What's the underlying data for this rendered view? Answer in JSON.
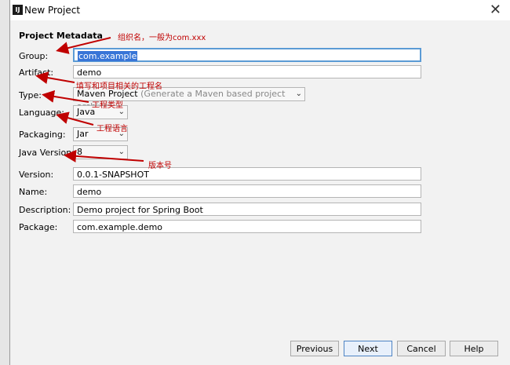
{
  "window": {
    "title": "New Project"
  },
  "section_title": "Project Metadata",
  "fields": {
    "group": {
      "label": "Group:",
      "value": "com.example"
    },
    "artifact": {
      "label": "Artifact:",
      "value": "demo"
    },
    "type": {
      "label": "Type:",
      "value": "Maven Project",
      "hint": "(Generate a Maven based project archive)"
    },
    "language": {
      "label": "Language:",
      "value": "Java"
    },
    "packaging": {
      "label": "Packaging:",
      "value": "Jar"
    },
    "java_version": {
      "label": "Java Version:",
      "value": "8"
    },
    "version": {
      "label": "Version:",
      "value": "0.0.1-SNAPSHOT"
    },
    "name": {
      "label": "Name:",
      "value": "demo"
    },
    "description": {
      "label": "Description:",
      "value": "Demo project for Spring Boot"
    },
    "package": {
      "label": "Package:",
      "value": "com.example.demo"
    }
  },
  "annotations": {
    "group": "组织名，一般为com.xxx",
    "artifact": "填写和项目相关的工程名",
    "type": "工程类型",
    "language": "工程语言",
    "java_version": "版本号"
  },
  "buttons": {
    "previous": "Previous",
    "next": "Next",
    "cancel": "Cancel",
    "help": "Help"
  },
  "colors": {
    "annotation": "#c00000",
    "focus_border": "#5b9bd5",
    "selection": "#3875d7"
  }
}
